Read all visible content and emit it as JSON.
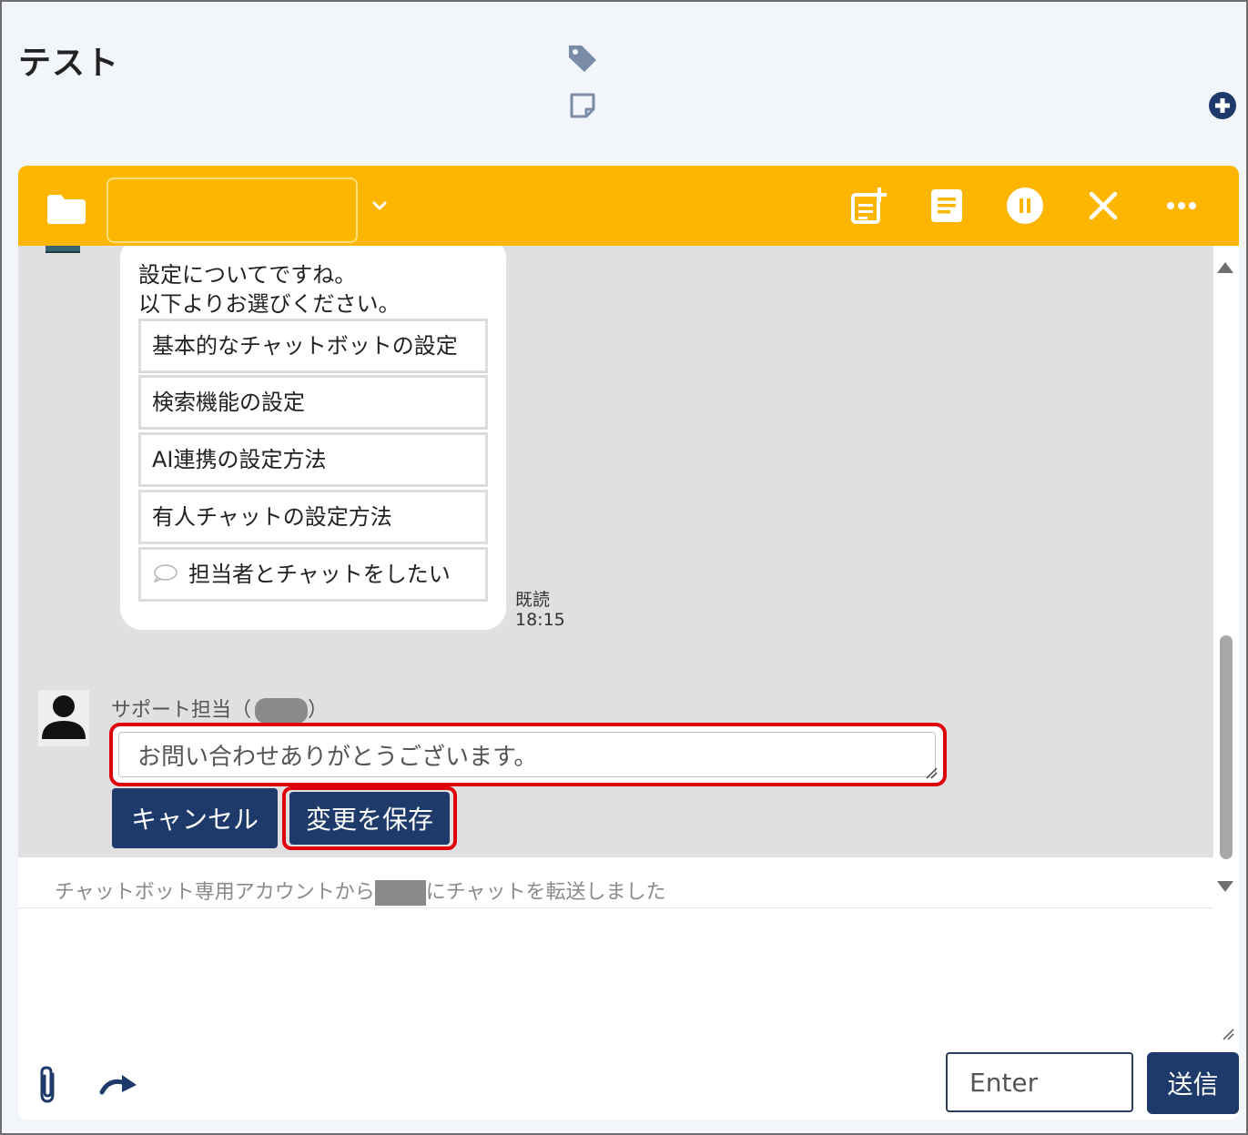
{
  "page": {
    "title": "テスト"
  },
  "icons": {
    "tag": "tag-icon",
    "note": "sticky-note-icon",
    "add": "plus-circle-icon",
    "folder": "folder-icon",
    "new_note": "note-add-icon",
    "document": "document-icon",
    "pause": "pause-icon",
    "close": "close-icon",
    "more": "more-icon",
    "attach": "paperclip-icon",
    "redo": "redo-icon"
  },
  "toolbar": {
    "status_value": ""
  },
  "bot_message": {
    "lines": [
      "設定についてですね。",
      "以下よりお選びください。"
    ],
    "options": [
      "基本的なチャットボットの設定",
      "検索機能の設定",
      "AI連携の設定方法",
      "有人チャットの設定方法"
    ],
    "handoff_option": "担当者とチャットをしたい",
    "read_label": "既読",
    "time": "18:15"
  },
  "agent_message": {
    "sender": "サポート担当（",
    "sender_close": "）",
    "edit_value": "お問い合わせありがとうございます。",
    "cancel_label": "キャンセル",
    "save_label": "変更を保存"
  },
  "system_message": {
    "before": "チャットボット専用アカウントから",
    "after": "にチャットを転送しました"
  },
  "composer": {
    "value": "",
    "enter_label": "Enter",
    "send_label": "送信"
  },
  "colors": {
    "toolbar": "#fdb600",
    "primary_button": "#1e3a6b",
    "highlight": "#e0000b",
    "messages_bg": "#e0e0e0"
  }
}
